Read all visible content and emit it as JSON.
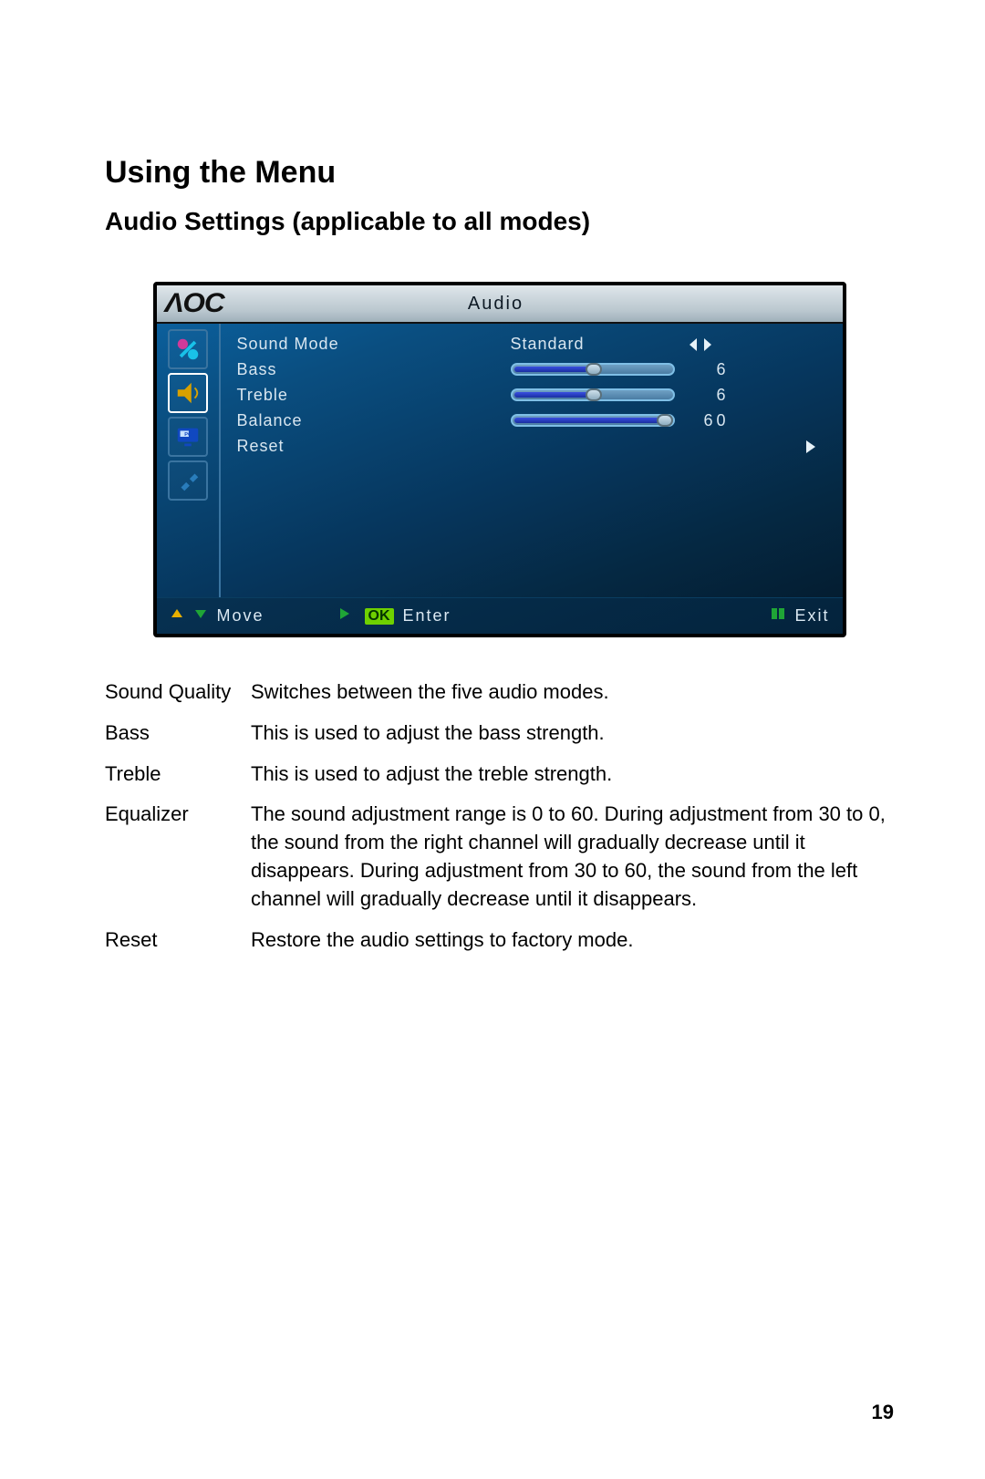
{
  "heading1": "Using the Menu",
  "heading2": "Audio Settings (applicable to all modes)",
  "osd": {
    "logo": "ΛOC",
    "title": "Audio",
    "rows": [
      {
        "label": "Sound Mode",
        "value": "Standard",
        "type": "select"
      },
      {
        "label": "Bass",
        "type": "slider",
        "value": "6",
        "pos": 50
      },
      {
        "label": "Treble",
        "type": "slider",
        "value": "6",
        "pos": 50
      },
      {
        "label": "Balance",
        "type": "slider",
        "value": "60",
        "pos": 100
      },
      {
        "label": "Reset",
        "type": "action"
      }
    ],
    "footer": {
      "move": "Move",
      "ok": "OK",
      "enter": "Enter",
      "exit": "Exit"
    }
  },
  "definitions": [
    {
      "term": "Sound Quality",
      "desc": "Switches between the five audio modes."
    },
    {
      "term": "Bass",
      "desc": "This is used to adjust the bass strength."
    },
    {
      "term": "Treble",
      "desc": "This is used to adjust the treble strength."
    },
    {
      "term": "Equalizer",
      "desc": "The sound adjustment range is 0 to 60. During adjustment from 30 to 0, the sound from the right channel will gradually decrease until it disappears. During adjustment from 30 to 60, the sound from the left channel will gradually decrease until it disappears."
    },
    {
      "term": "Reset",
      "desc": "Restore the audio settings to factory mode."
    }
  ],
  "page_number": "19"
}
